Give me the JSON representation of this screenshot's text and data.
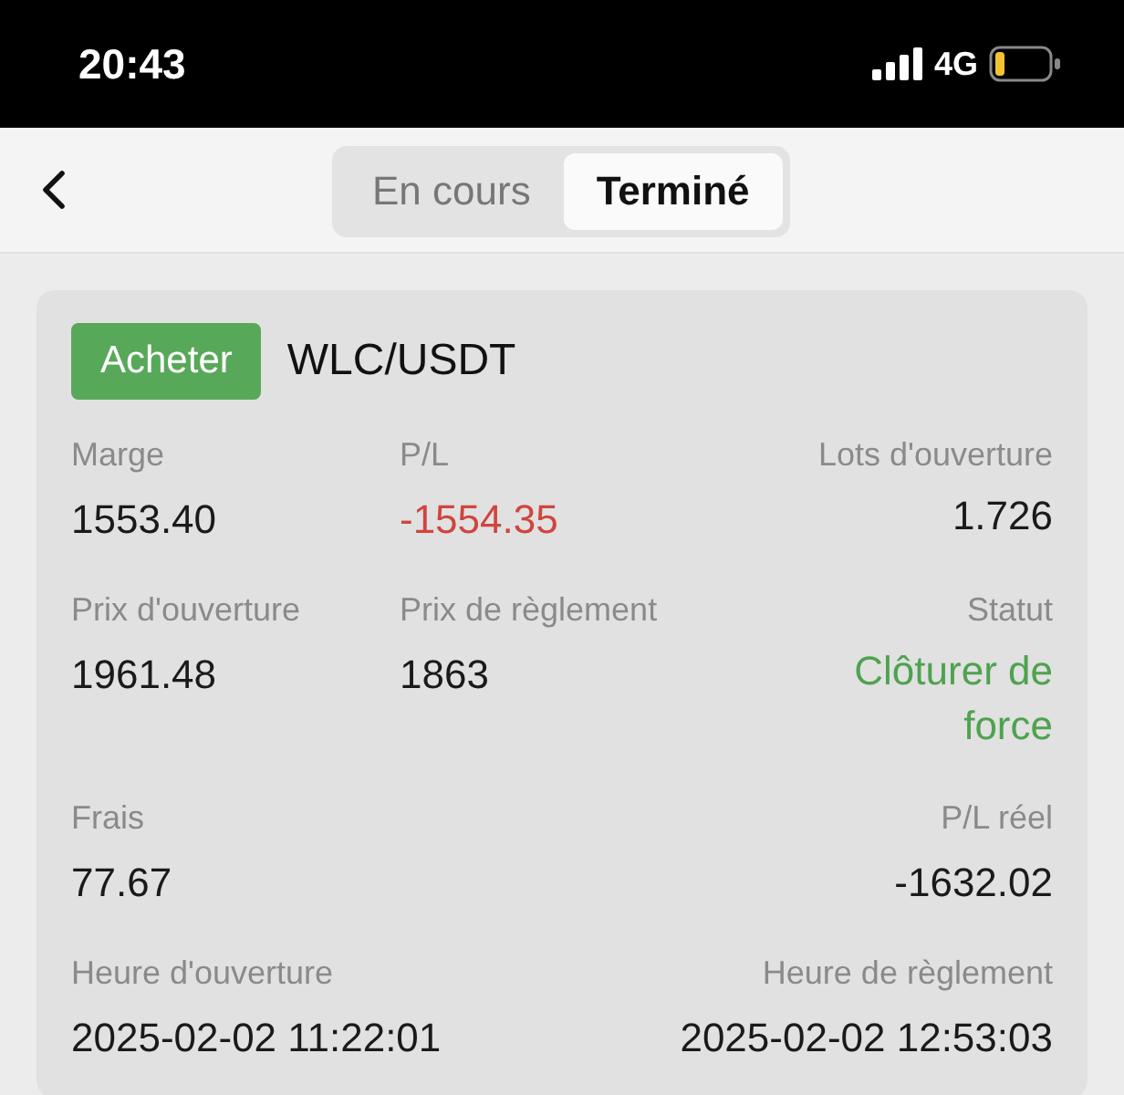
{
  "status_bar": {
    "time": "20:43",
    "network": "4G"
  },
  "tabs": [
    {
      "label": "En cours",
      "selected": false
    },
    {
      "label": "Terminé",
      "selected": true
    }
  ],
  "order": {
    "side": "Acheter",
    "pair": "WLC/USDT",
    "rows": [
      {
        "left": {
          "label": "Marge",
          "value": "1553.40",
          "color": "#1a1a1a"
        },
        "middle": {
          "label": "P/L",
          "value": "-1554.35",
          "color": "#d0453f"
        },
        "right": {
          "label": "Lots d'ouverture",
          "value": "1.726",
          "color": "#1a1a1a"
        }
      },
      {
        "left": {
          "label": "Prix d'ouverture",
          "value": "1961.48",
          "color": "#1a1a1a"
        },
        "middle": {
          "label": "Prix de règlement",
          "value": "1863",
          "color": "#1a1a1a"
        },
        "right": {
          "label": "Statut",
          "value": "Clôturer de force",
          "color": "#4fa24f"
        }
      },
      {
        "left": {
          "label": "Frais",
          "value": "77.67",
          "color": "#1a1a1a"
        },
        "right": {
          "label": "P/L réel",
          "value": "-1632.02",
          "color": "#1a1a1a"
        }
      },
      {
        "left": {
          "label": "Heure d'ouverture",
          "value": "2025-02-02 11:22:01",
          "color": "#1a1a1a"
        },
        "right": {
          "label": "Heure de règlement",
          "value": "2025-02-02 12:53:03",
          "color": "#1a1a1a"
        }
      }
    ]
  }
}
